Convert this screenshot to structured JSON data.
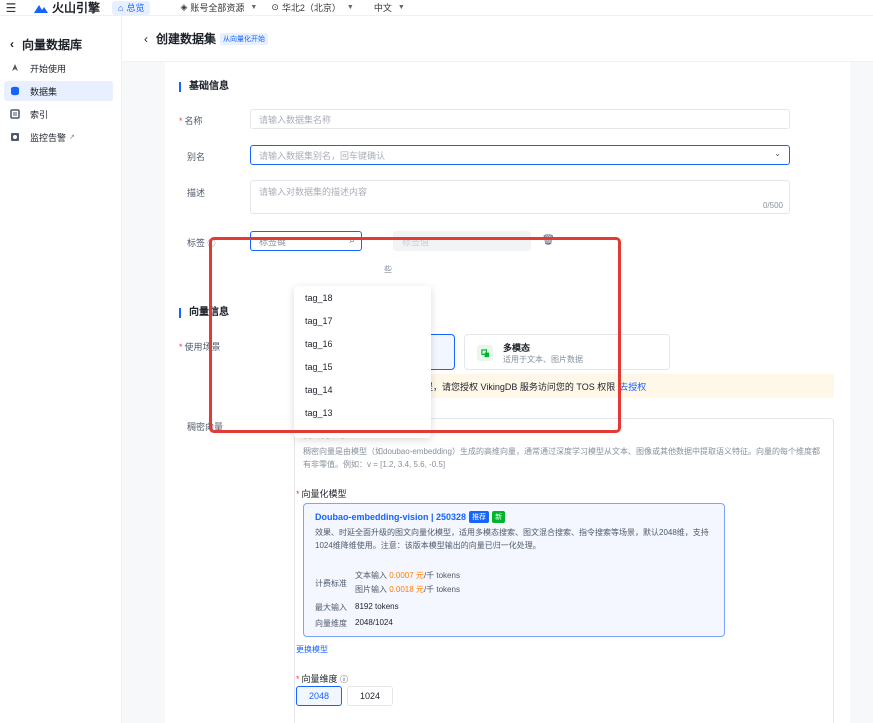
{
  "topbar": {
    "brand": "火山引擎",
    "home_pill": "总览",
    "account": "账号全部资源",
    "region": "华北2（北京）",
    "language": "中文"
  },
  "sidebar": {
    "title": "向量数据库",
    "items": [
      {
        "label": "开始使用",
        "icon": "rocket-icon"
      },
      {
        "label": "数据集",
        "icon": "database-icon"
      },
      {
        "label": "索引",
        "icon": "index-icon"
      },
      {
        "label": "监控告警",
        "icon": "alarm-icon"
      }
    ]
  },
  "page": {
    "title": "创建数据集",
    "badge": "从向量化开始"
  },
  "basic": {
    "section_title": "基础信息",
    "name_label": "名称",
    "name_placeholder": "请输入数据集名称",
    "alias_label": "别名",
    "alias_placeholder": "请输入数据集别名，回车键确认",
    "desc_label": "描述",
    "desc_placeholder": "请输入对数据集的描述内容",
    "desc_counter": "0/500",
    "tags_label": "标签",
    "tag_key_placeholder": "标签键",
    "tag_value_placeholder": "标签值",
    "tag_hint_fragment": "些"
  },
  "tag_dropdown": [
    "tag_18",
    "tag_17",
    "tag_16",
    "tag_15",
    "tag_14",
    "tag_13"
  ],
  "vector": {
    "section_title": "向量信息",
    "scene_label": "使用场景",
    "scene_selected_desc_fragment": "等",
    "scene_multi_name": "多模态",
    "scene_multi_desc": "适用于文本、图片数据",
    "notice_text": "提，请您授权 VikingDB 服务访问您的 TOS 权限",
    "notice_link": "去授权",
    "dense_label": "稠密向量",
    "dense_title": "稠密向量字段与模型配置",
    "dense_desc": "稠密向量是由模型（如doubao-embedding）生成的高维向量，通常通过深度学习模型从文本、图像或其他数据中提取语义特征。向量的每个维度都有非零值。例如：v = [1.2, 3.4, 5.6, -0.5]",
    "model_label": "向量化模型",
    "model_name": "Doubao-embedding-vision | 250328",
    "badge_rec": "推荐",
    "badge_new": "新",
    "model_desc": "效果、时延全面升级的图文向量化模型，适用多模态搜索、图文混合搜索、指令搜索等场景，默认2048维，支持1024维降维使用。注意：该版本模型输出的向量已归一化处理。",
    "pricing_label": "计费标准",
    "text_input_label": "文本输入",
    "text_input_price": "0.0007 元",
    "text_input_unit": "/千 tokens",
    "image_input_label": "图片输入",
    "image_input_price": "0.0018 元",
    "image_input_unit": "/千 tokens",
    "max_input_label": "最大输入",
    "max_input_value": "8192 tokens",
    "dim_label": "向量维度",
    "dim_value": "2048/1024",
    "change_model": "更换模型",
    "dim_select_label": "向量维度",
    "dim_options": [
      "2048",
      "1024"
    ]
  },
  "colors": {
    "accent": "#1664ff",
    "highlight_box": "#e53935",
    "price": "#ff7d00"
  }
}
